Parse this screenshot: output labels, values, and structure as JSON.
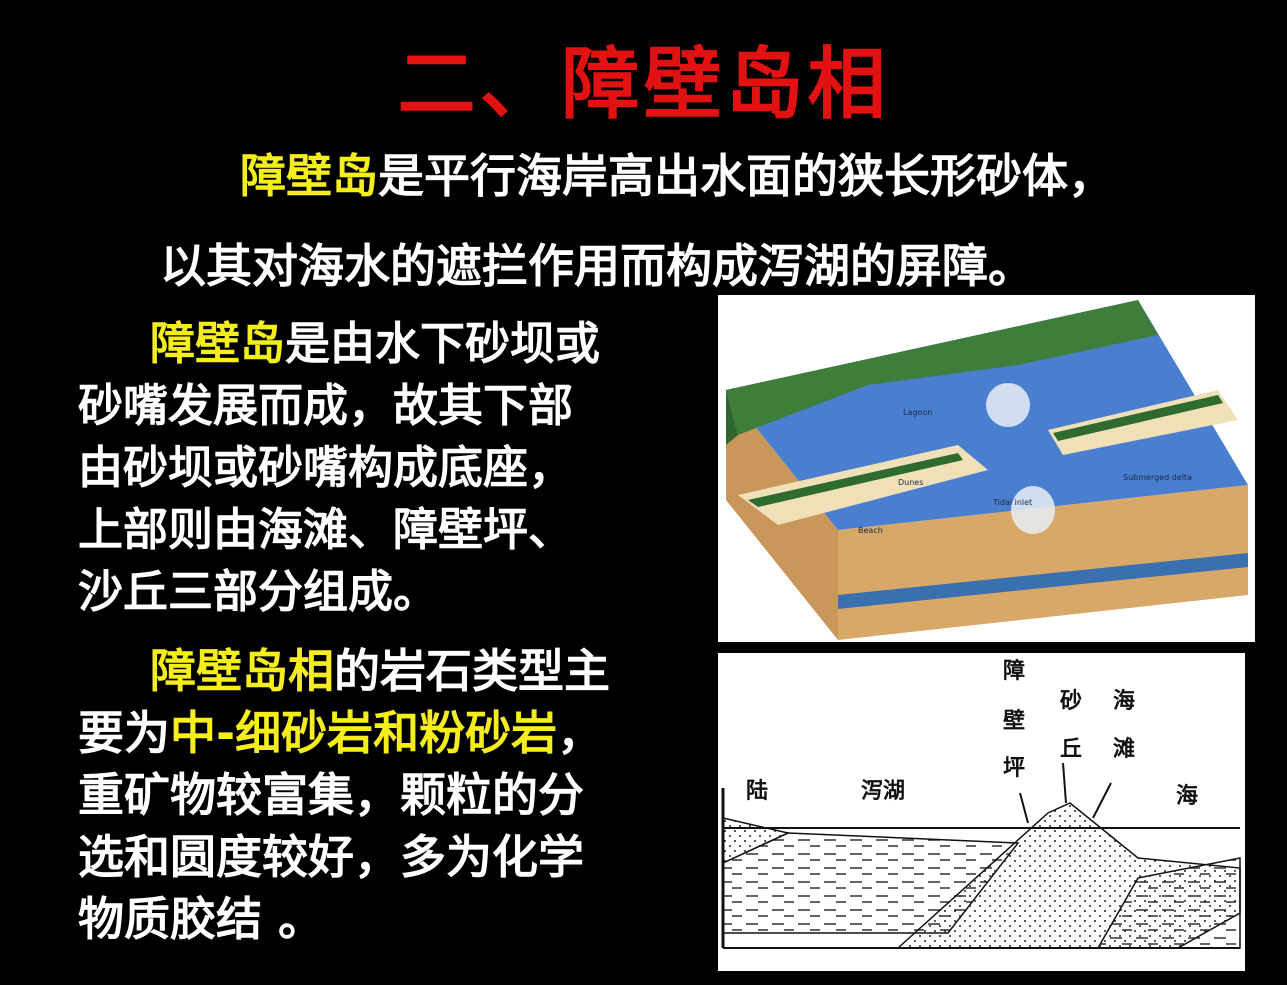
{
  "title": "二、障壁岛相",
  "intro": {
    "highlight": "障壁岛",
    "line1_rest": "是平行海岸高出水面的狭长形砂体，",
    "line2": "以其对海水的遮拦作用而构成泻湖的屏障。"
  },
  "paragraph1": {
    "highlight": "障壁岛",
    "line1_rest": "是由水下砂坝或",
    "line2": "砂嘴发展而成，故其下部",
    "line3": "由砂坝或砂嘴构成底座，",
    "line4": "上部则由海滩、障壁坪、",
    "line5": "沙丘三部分组成。"
  },
  "paragraph2": {
    "highlight1": "障壁岛相",
    "line1_rest": "的岩石类型主",
    "line2_pre": "要为",
    "highlight2": "中-细砂岩和粉砂岩",
    "line2_post": "，",
    "line3": "重矿物较富集，颗粒的分",
    "line4": "选和圆度较好，多为化学",
    "line5": "物质胶结 。"
  },
  "block_diagram": {
    "labels": [
      "Lagoon",
      "Dunes",
      "Beach",
      "Tidal inlet",
      "Submerged delta"
    ]
  },
  "cross_section": {
    "label_land": "陆",
    "label_lagoon": "泻湖",
    "label_flat": [
      "障",
      "壁",
      "坪"
    ],
    "label_dune": [
      "砂",
      "丘"
    ],
    "label_beach": [
      "海",
      "滩"
    ],
    "label_sea": "海"
  },
  "colors": {
    "title": "#e31212",
    "highlight": "#f5ee1a",
    "text": "#ffffff",
    "background": "#000000"
  }
}
